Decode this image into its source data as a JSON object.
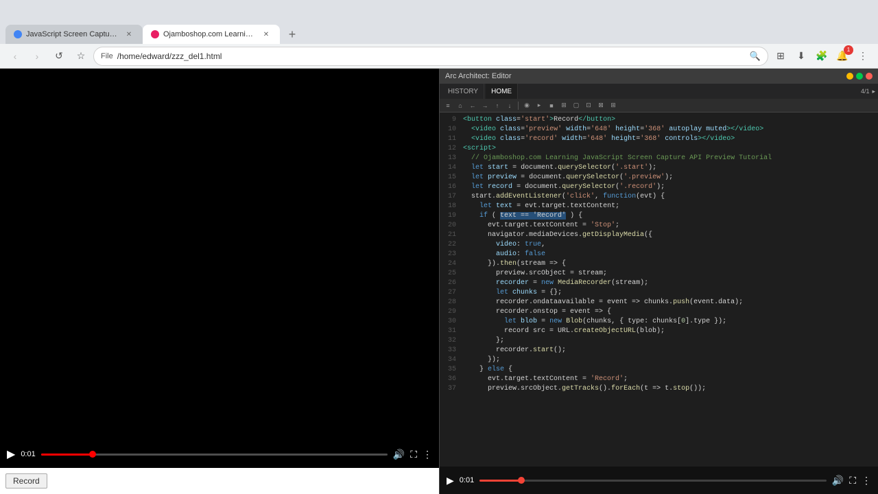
{
  "browser": {
    "tabs": [
      {
        "id": "tab1",
        "label": "JavaScript Screen Capture API ...",
        "active": false,
        "icon_color": "#4285f4"
      },
      {
        "id": "tab2",
        "label": "Ojamboshop.com Learning...",
        "active": true,
        "icon_color": "#e91e63"
      }
    ],
    "new_tab_label": "+",
    "nav": {
      "back": "‹",
      "forward": "›",
      "refresh": "↺",
      "bookmark": "☆"
    },
    "address": "/home/edward/zzz_del1.html",
    "address_protocol": "File",
    "search_icon": "🔍",
    "toolbar_icons": [
      "⊞",
      "⬇",
      "⚙",
      "🔔",
      "⋮"
    ],
    "notification_count": "1"
  },
  "left_panel": {
    "record_button_label": "Record"
  },
  "video_player": {
    "play_icon": "▶",
    "time": "0:01",
    "volume_icon": "🔊",
    "fullscreen_icon": "⛶",
    "more_icon": "⋮"
  },
  "editor": {
    "title": "Arc Architect: Editor",
    "tab_labels": [
      "HISTORY",
      "HOME"
    ],
    "toolbar_icons": [
      "≡",
      "⌂",
      "←",
      "→",
      "↑",
      "↓",
      "◉",
      "▸",
      "■",
      "⊞",
      "▢",
      "⊡",
      "⊠",
      "⊞"
    ],
    "line_start": 9,
    "code_lines": [
      "<button class='start'>Record</button>",
      "  <video class='preview' width='648' height='368' autoplay muted></video>",
      "  <video class='record' width='648' height='368' controls></video>",
      "<script>",
      "  // Ojamboshop.com Learning JavaScript Screen Capture API Preview Tutorial",
      "  let start = document.querySelector('.start');",
      "  let preview = document.querySelector('.preview');",
      "  let record = document.querySelector('.record');",
      "  start.addEventListener('click', function(evt) {",
      "    let text = evt.target.textContent;",
      "    if ( text == 'Record' ) {",
      "      evt.target.textContent = 'Stop';",
      "      navigator.mediaDevices.getDisplayMedia({",
      "        video: true,",
      "        audio: false",
      "      }).then(stream => {",
      "        preview.srcObject = stream;",
      "        recorder = new MediaRecorder(stream);",
      "        let chunks = {};",
      "        recorder.ondataavailable = event => chunks.push(event.data);",
      "        recorder.onstop = event => {",
      "          let blob = new Blob(chunks, { type: chunks[0].type });",
      "          record src = URL.createObjectURL(blob);",
      "        };",
      "        recorder.start();",
      "      });",
      "    } else {",
      "      evt.target.textContent = 'Record';",
      "      preview.srcObject.getTracks().forEach(t => t.stop());"
    ]
  }
}
